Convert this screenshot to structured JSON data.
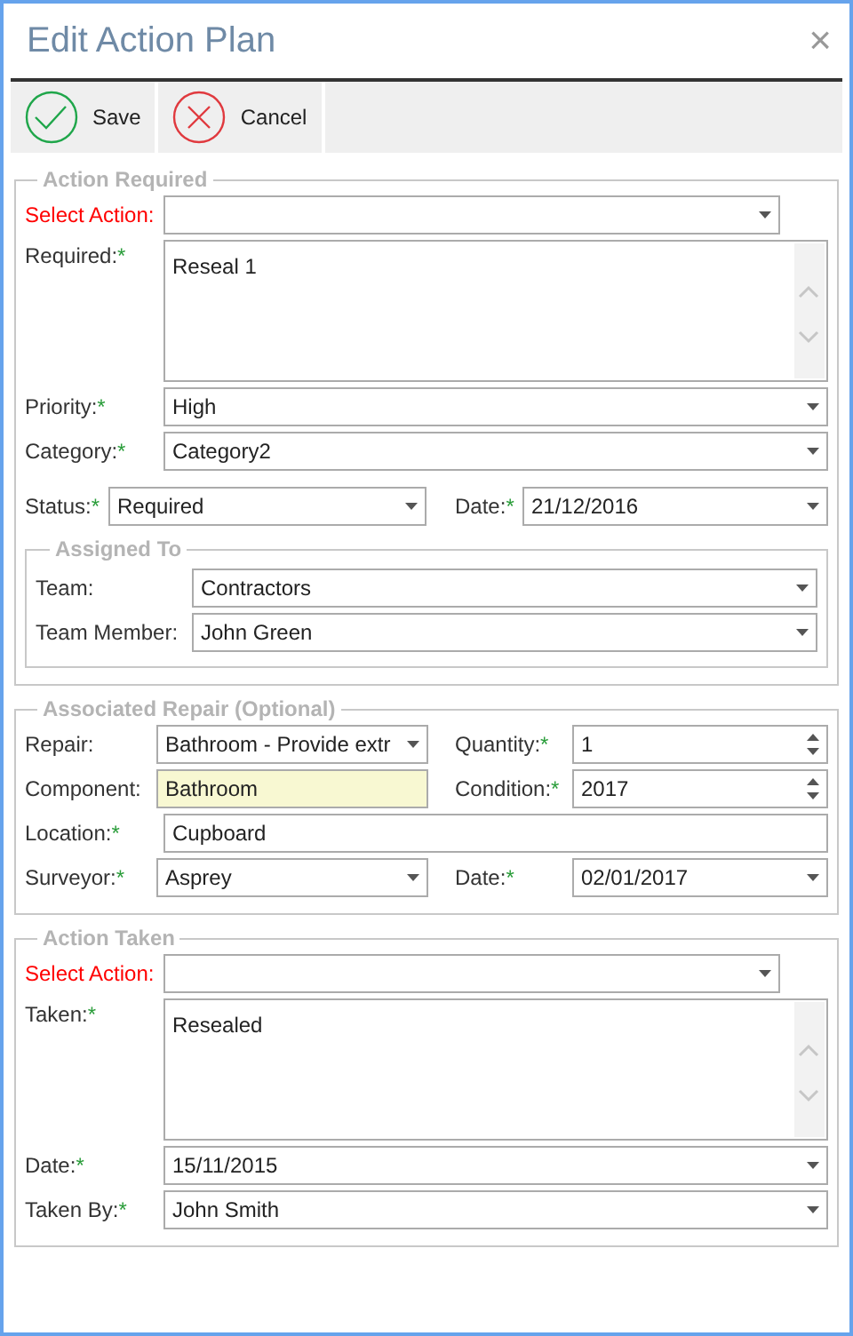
{
  "window": {
    "title": "Edit Action Plan",
    "close": "×"
  },
  "toolbar": [
    {
      "kind": "save",
      "label": "Save"
    },
    {
      "kind": "cancel",
      "label": "Cancel"
    }
  ],
  "sections": [
    {
      "legend": "Action Required",
      "items": [
        {
          "kind": "wide",
          "fields": [
            {
              "kind": "combo",
              "label": "Select Action:",
              "alert": true,
              "short": true
            }
          ]
        },
        {
          "kind": "wide",
          "fields": [
            {
              "kind": "memo",
              "label": "Required:",
              "asterisk": "*",
              "value": "Reseal 1"
            }
          ]
        },
        {
          "kind": "wide",
          "fields": [
            {
              "kind": "combo",
              "label": "Priority:",
              "asterisk": "*",
              "value": "High"
            }
          ]
        },
        {
          "kind": "wide",
          "fields": [
            {
              "kind": "combo",
              "label": "Category:",
              "asterisk": "*",
              "value": "Category2"
            }
          ]
        },
        {
          "kind": "compact-pair",
          "fields": [
            {
              "kind": "combo",
              "label": "Status:",
              "asterisk": "*",
              "value": "Required"
            },
            {
              "kind": "combo",
              "label": "Date:",
              "asterisk": "*",
              "value": "21/12/2016"
            }
          ]
        },
        {
          "kind": "group",
          "legend": "Assigned To",
          "rows": [
            {
              "kind": "wide",
              "fields": [
                {
                  "kind": "combo",
                  "label": "Team:",
                  "value": "Contractors"
                }
              ]
            },
            {
              "kind": "wide",
              "fields": [
                {
                  "kind": "combo",
                  "label": "Team Member:",
                  "value": "John Green"
                }
              ]
            }
          ]
        }
      ]
    },
    {
      "legend": "Associated Repair (Optional)",
      "items": [
        {
          "kind": "pair",
          "fields": [
            {
              "kind": "combo",
              "label": "Repair:",
              "value": "Bathroom - Provide extr"
            },
            {
              "kind": "spin",
              "label": "Quantity:",
              "asterisk": "*",
              "value": "1"
            }
          ]
        },
        {
          "kind": "pair",
          "fields": [
            {
              "kind": "text",
              "label": "Component:",
              "value": "Bathroom",
              "highlighted": true
            },
            {
              "kind": "spin",
              "label": "Condition:",
              "asterisk": "*",
              "value": "2017"
            }
          ]
        },
        {
          "kind": "wide",
          "fields": [
            {
              "kind": "text",
              "label": "Location:",
              "asterisk": "*",
              "value": "Cupboard"
            }
          ]
        },
        {
          "kind": "pair",
          "fields": [
            {
              "kind": "combo",
              "label": "Surveyor:",
              "asterisk": "*",
              "value": "Asprey"
            },
            {
              "kind": "combo",
              "label": "Date:",
              "asterisk": "*",
              "value": "02/01/2017"
            }
          ]
        }
      ]
    },
    {
      "legend": "Action Taken",
      "items": [
        {
          "kind": "wide",
          "fields": [
            {
              "kind": "combo",
              "label": "Select Action:",
              "alert": true,
              "short": true
            }
          ]
        },
        {
          "kind": "wide",
          "fields": [
            {
              "kind": "memo",
              "label": "Taken:",
              "asterisk": "*",
              "value": "Resealed"
            }
          ]
        },
        {
          "kind": "wide",
          "fields": [
            {
              "kind": "combo",
              "label": "Date:",
              "asterisk": "*",
              "value": "15/11/2015"
            }
          ]
        },
        {
          "kind": "wide",
          "fields": [
            {
              "kind": "combo",
              "label": "Taken By:",
              "asterisk": "*",
              "value": "John Smith"
            }
          ]
        }
      ]
    }
  ]
}
